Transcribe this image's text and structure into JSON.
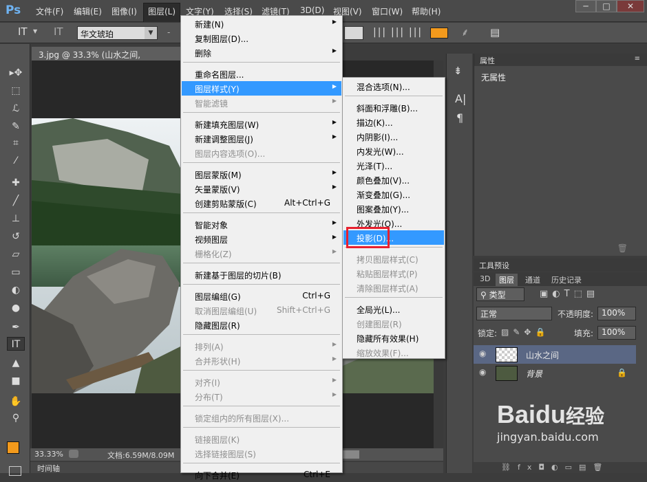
{
  "app": {
    "logo": "Ps"
  },
  "menubar": {
    "items": [
      "文件(F)",
      "编辑(E)",
      "图像(I)",
      "图层(L)",
      "文字(Y)",
      "选择(S)",
      "滤镜(T)",
      "3D(D)",
      "视图(V)",
      "窗口(W)",
      "帮助(H)"
    ],
    "active_index": 3
  },
  "window_controls": {
    "minimize": "─",
    "maximize": "□",
    "close": "✕"
  },
  "options": {
    "font_family": "华文琥珀",
    "font_style": "-",
    "accent_color": "#f39a1c"
  },
  "document": {
    "tab_title": "3.jpg @ 33.3% (山水之间, RGB/8#) *",
    "tab_close": "×"
  },
  "status": {
    "zoom": "33.33%",
    "doc_size": "文档:6.59M/8.09M"
  },
  "timeline": {
    "label": "时间轴"
  },
  "properties": {
    "title": "属性",
    "content": "无属性"
  },
  "toolpreset": {
    "title": "工具预设"
  },
  "layers_panel": {
    "tabs": [
      "3D",
      "图层",
      "通道",
      "历史记录"
    ],
    "active_tab": 1,
    "filter_kind": "类型",
    "blend_mode": "正常",
    "opacity_label": "不透明度:",
    "opacity_value": "100%",
    "lock_label": "锁定:",
    "fill_label": "填充:",
    "fill_value": "100%",
    "layers": [
      {
        "name": "山水之间",
        "type": "text",
        "selected": true
      },
      {
        "name": "背景",
        "type": "image",
        "locked": true,
        "italic": true
      }
    ]
  },
  "layer_menu": {
    "items": [
      {
        "label": "新建(N)",
        "submenu": true
      },
      {
        "label": "复制图层(D)..."
      },
      {
        "label": "删除",
        "submenu": true
      },
      {
        "sep": true
      },
      {
        "label": "重命名图层..."
      },
      {
        "label": "图层样式(Y)",
        "submenu": true,
        "selected": true
      },
      {
        "label": "智能滤镜",
        "submenu": true,
        "disabled": true
      },
      {
        "sep": true
      },
      {
        "label": "新建填充图层(W)",
        "submenu": true
      },
      {
        "label": "新建调整图层(J)",
        "submenu": true
      },
      {
        "label": "图层内容选项(O)...",
        "disabled": true
      },
      {
        "sep": true
      },
      {
        "label": "图层蒙版(M)",
        "submenu": true
      },
      {
        "label": "矢量蒙版(V)",
        "submenu": true
      },
      {
        "label": "创建剪贴蒙版(C)",
        "shortcut": "Alt+Ctrl+G"
      },
      {
        "sep": true
      },
      {
        "label": "智能对象",
        "submenu": true
      },
      {
        "label": "视频图层",
        "submenu": true
      },
      {
        "label": "栅格化(Z)",
        "submenu": true,
        "disabled": true
      },
      {
        "sep": true
      },
      {
        "label": "新建基于图层的切片(B)"
      },
      {
        "sep": true
      },
      {
        "label": "图层编组(G)",
        "shortcut": "Ctrl+G"
      },
      {
        "label": "取消图层编组(U)",
        "shortcut": "Shift+Ctrl+G",
        "disabled": true
      },
      {
        "label": "隐藏图层(R)"
      },
      {
        "sep": true
      },
      {
        "label": "排列(A)",
        "submenu": true,
        "disabled": true
      },
      {
        "label": "合并形状(H)",
        "submenu": true,
        "disabled": true
      },
      {
        "sep": true
      },
      {
        "label": "对齐(I)",
        "submenu": true,
        "disabled": true
      },
      {
        "label": "分布(T)",
        "submenu": true,
        "disabled": true
      },
      {
        "sep": true
      },
      {
        "label": "锁定组内的所有图层(X)...",
        "disabled": true
      },
      {
        "sep": true
      },
      {
        "label": "链接图层(K)",
        "disabled": true
      },
      {
        "label": "选择链接图层(S)",
        "disabled": true
      },
      {
        "sep": true
      },
      {
        "label": "向下合并(E)",
        "shortcut": "Ctrl+E"
      }
    ]
  },
  "style_submenu": {
    "items": [
      {
        "label": "混合选项(N)..."
      },
      {
        "sep": true
      },
      {
        "label": "斜面和浮雕(B)..."
      },
      {
        "label": "描边(K)..."
      },
      {
        "label": "内阴影(I)..."
      },
      {
        "label": "内发光(W)..."
      },
      {
        "label": "光泽(T)..."
      },
      {
        "label": "颜色叠加(V)..."
      },
      {
        "label": "渐变叠加(G)..."
      },
      {
        "label": "图案叠加(Y)..."
      },
      {
        "label": "外发光(O)..."
      },
      {
        "label": "投影(D)...",
        "selected": true
      },
      {
        "sep": true
      },
      {
        "label": "拷贝图层样式(C)",
        "disabled": true
      },
      {
        "label": "粘贴图层样式(P)",
        "disabled": true
      },
      {
        "label": "清除图层样式(A)",
        "disabled": true
      },
      {
        "sep": true
      },
      {
        "label": "全局光(L)..."
      },
      {
        "label": "创建图层(R)",
        "disabled": true
      },
      {
        "label": "隐藏所有效果(H)"
      },
      {
        "label": "缩放效果(F)...",
        "disabled": true
      }
    ]
  },
  "watermark": {
    "brand": "Baidu",
    "brand_cn": "经验",
    "url": "jingyan.baidu.com"
  }
}
